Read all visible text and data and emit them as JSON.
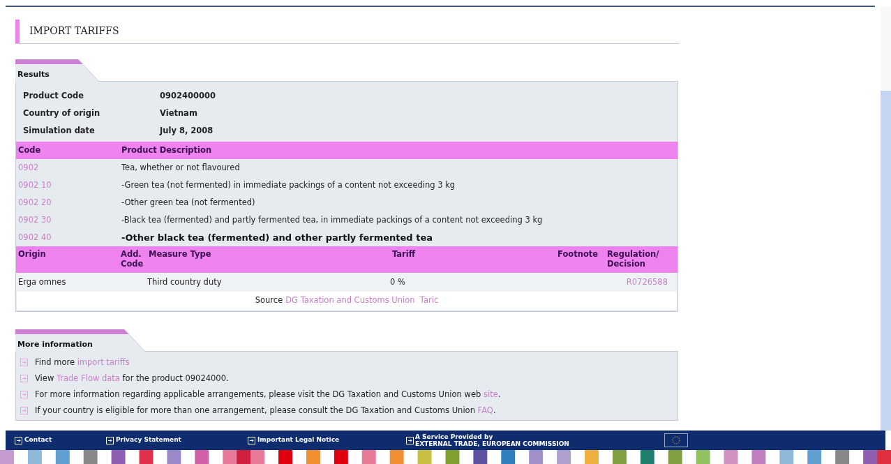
{
  "page_title": "IMPORT TARIFFS",
  "results": {
    "tab": "Results",
    "summary": [
      {
        "label": "Product Code",
        "value": "0902400000"
      },
      {
        "label": "Country of origin",
        "value": "Vietnam"
      },
      {
        "label": "Simulation date",
        "value": "July 8, 2008"
      }
    ],
    "products": {
      "columns": [
        "Code",
        "Product Description"
      ],
      "rows": [
        {
          "code": "0902",
          "description": "Tea, whether or not flavoured",
          "selected": false
        },
        {
          "code": "0902 10",
          "description": "-Green tea (not fermented) in immediate packings of a content not exceeding 3 kg",
          "selected": false
        },
        {
          "code": "0902 20",
          "description": "-Other green tea (not fermented)",
          "selected": false
        },
        {
          "code": "0902 30",
          "description": "-Black tea (fermented) and partly fermented tea, in immediate packings of a content not exceeding 3 kg",
          "selected": false
        },
        {
          "code": "0902 40",
          "description": "-Other black tea (fermented) and other partly fermented tea",
          "selected": true
        }
      ]
    },
    "measures": {
      "columns": [
        "Origin",
        "Add. Code",
        "Measure Type",
        "Tariff",
        "Footnote",
        "Regulation/ Decision"
      ],
      "rows": [
        {
          "origin": "Erga omnes",
          "measure_type": "Third country duty",
          "tariff": "0 %",
          "regulation": "R0726588"
        }
      ]
    },
    "source": {
      "label": "Source",
      "link": "DG Taxation and Customs Union  Taric"
    }
  },
  "more_information": {
    "tab": "More information",
    "items": [
      {
        "before": "Find more",
        "link": "import tariffs"
      },
      {
        "before": "View",
        "link": "Trade Flow data",
        "after": "for the product 09024000."
      },
      {
        "before": "For more information regarding applicable arrangements, please visit the DG Taxation and Customs Union web",
        "link": "site",
        "after": "."
      },
      {
        "before": "If your country is eligible for more than one arrangement, please consult the DG Taxation and Customs Union",
        "link": "FAQ",
        "after": "."
      }
    ]
  },
  "footer": {
    "links": [
      "Contact",
      "Privacy Statement",
      "Important Legal Notice"
    ],
    "service": {
      "line1": "A Service Provided by",
      "line2": "EXTERNAL TRADE, EUROPEAN COMMISSION"
    }
  }
}
